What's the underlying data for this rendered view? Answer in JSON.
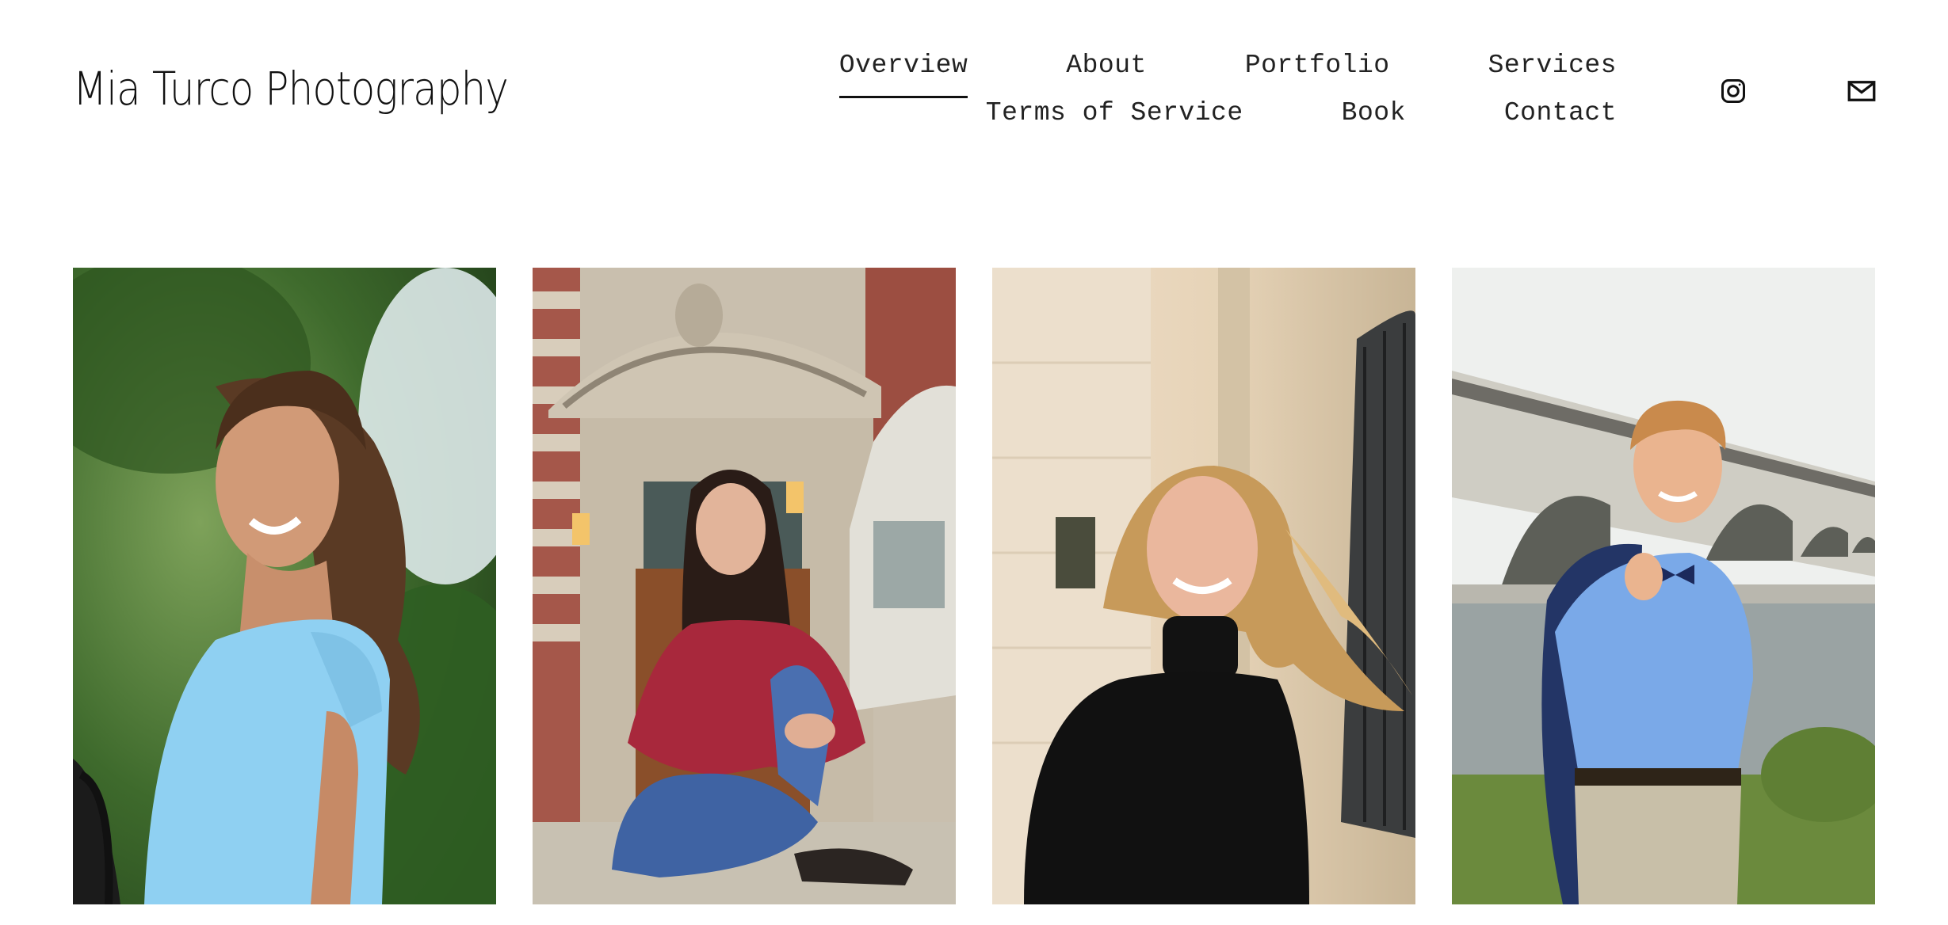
{
  "site": {
    "title": "Mia Turco Photography"
  },
  "nav": {
    "row1": [
      "Overview",
      "About",
      "Portfolio",
      "Services"
    ],
    "row2": [
      "Terms of Service",
      "Book",
      "Contact"
    ],
    "active": "Overview"
  },
  "social": [
    {
      "icon": "instagram-icon"
    },
    {
      "icon": "email-icon"
    }
  ],
  "colors": {
    "text": "#111111",
    "background": "#ffffff"
  }
}
